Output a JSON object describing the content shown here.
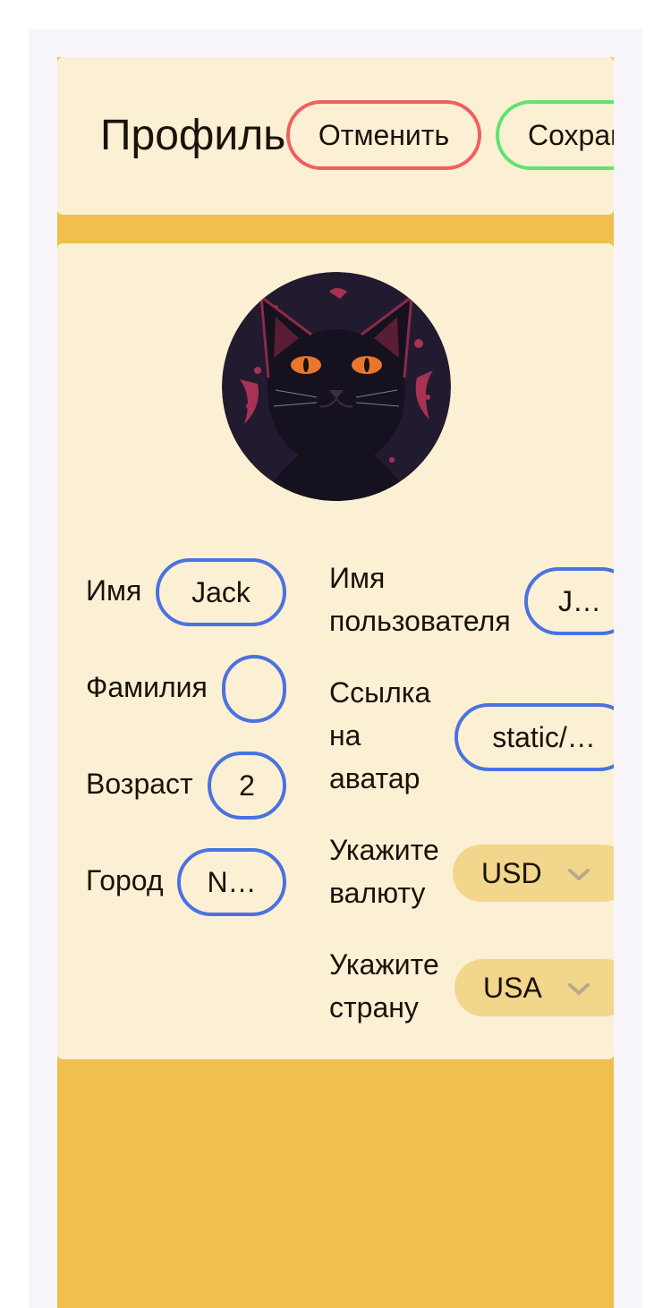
{
  "header": {
    "title": "Профиль",
    "cancel_label": "Отменить",
    "save_label": "Сохранить"
  },
  "form": {
    "first_name": {
      "label": "Имя",
      "value": "Jack"
    },
    "last_name": {
      "label": "Фамилия",
      "value": ""
    },
    "age": {
      "label": "Возраст",
      "value": "2"
    },
    "city": {
      "label": "Город",
      "value": "N…"
    },
    "username": {
      "label_line1": "Имя",
      "label_line2": "пользователя",
      "value": "J…"
    },
    "avatar_link": {
      "label_line1": "Ссылка",
      "label_line2": "на",
      "label_line3": "аватар",
      "value": "static/…"
    },
    "currency": {
      "label_line1": "Укажите",
      "label_line2": "валюту",
      "value": "USD"
    },
    "country": {
      "label_line1": "Укажите",
      "label_line2": "страну",
      "value": "USA"
    }
  },
  "colors": {
    "page_bg": "#efc04b",
    "panel_bg": "#fcf0d4",
    "cancel_border": "#f05f5f",
    "save_border": "#5ee46e",
    "input_border": "#4a72e0",
    "select_bg": "#f1d68b"
  },
  "icons": {
    "avatar": "black-cat-avatar",
    "select_arrow": "chevron-down-icon"
  }
}
